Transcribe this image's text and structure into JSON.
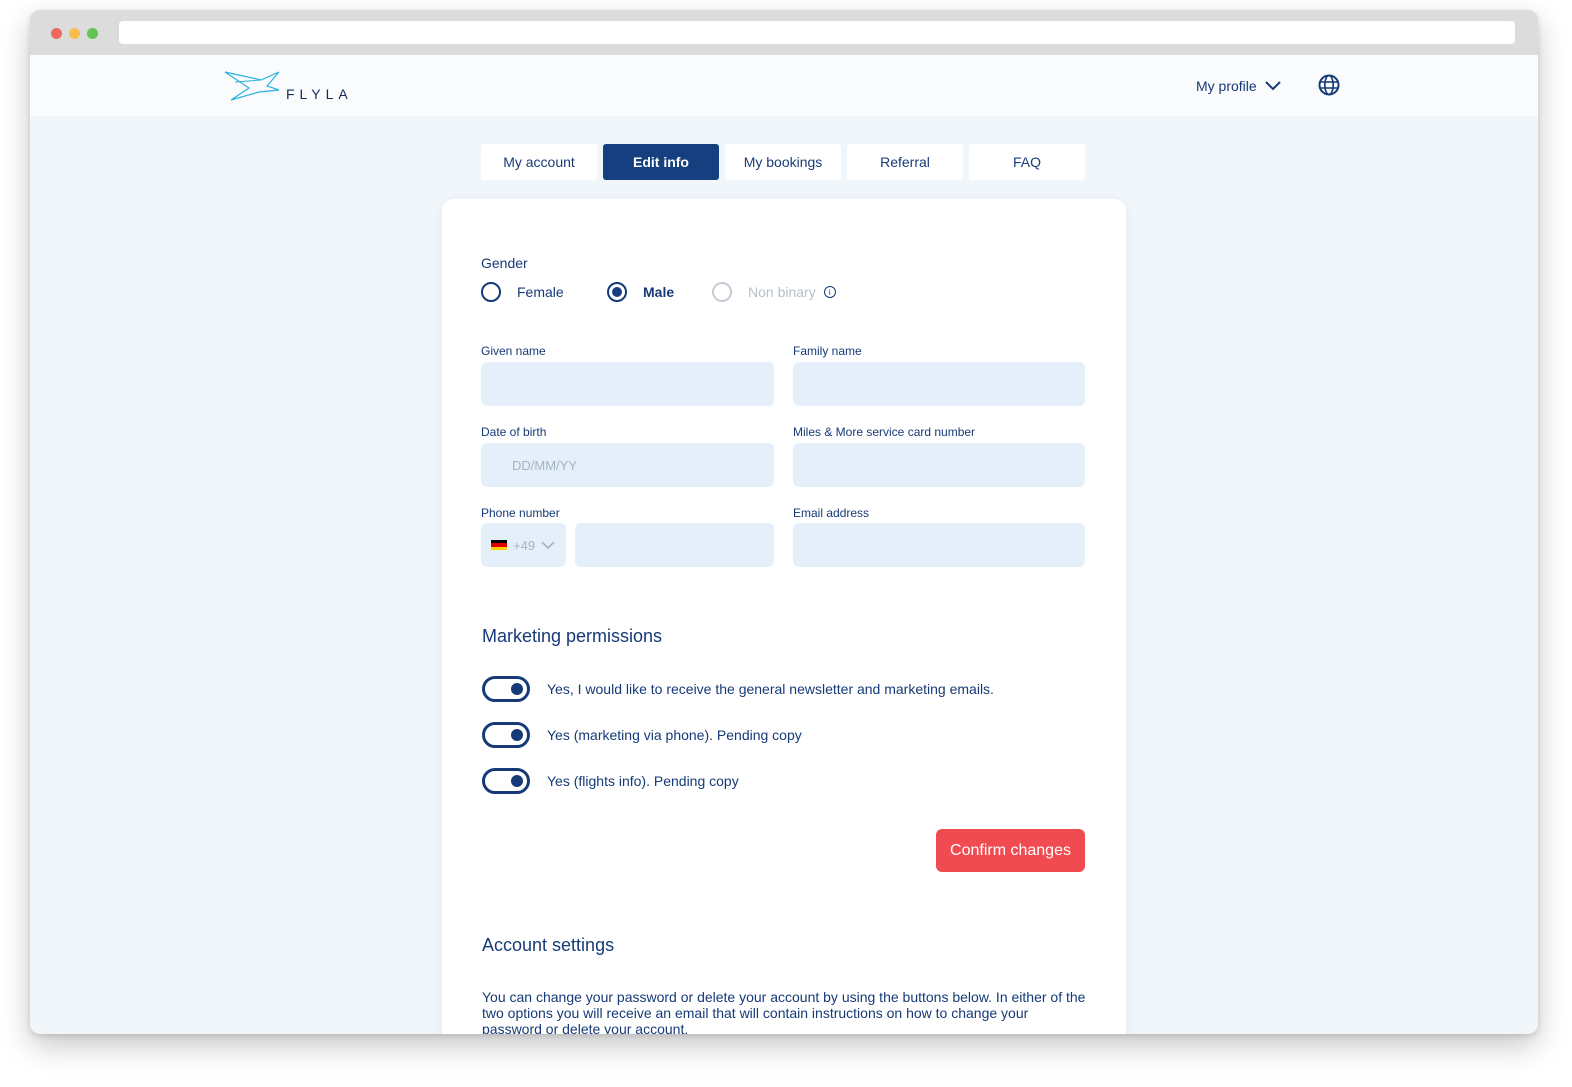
{
  "brand": {
    "name": "FLYLA",
    "accent": "#163f80",
    "cta_color": "#ef4b51"
  },
  "header": {
    "profile_label": "My profile",
    "profile_icon": "chevron-down-icon",
    "language_icon": "globe-icon"
  },
  "tabs": [
    {
      "label": "My account",
      "active": false
    },
    {
      "label": "Edit info",
      "active": true
    },
    {
      "label": "My bookings",
      "active": false
    },
    {
      "label": "Referral",
      "active": false
    },
    {
      "label": "FAQ",
      "active": false
    }
  ],
  "form": {
    "gender": {
      "label": "Gender",
      "options": [
        {
          "label": "Female",
          "checked": false,
          "disabled": false
        },
        {
          "label": "Male",
          "checked": true,
          "disabled": false
        },
        {
          "label": "Non binary",
          "checked": false,
          "disabled": true
        }
      ]
    },
    "given_name": {
      "label": "Given name",
      "value": ""
    },
    "family_name": {
      "label": "Family name",
      "value": ""
    },
    "date_of_birth": {
      "label": "Date of birth",
      "placeholder": "DD/MM/YY",
      "value": ""
    },
    "miles_card": {
      "label": "Miles & More service card number",
      "value": ""
    },
    "phone": {
      "label": "Phone number",
      "country_code": "+49",
      "country_flag": "de-flag",
      "value": ""
    },
    "email": {
      "label": "Email address",
      "value": ""
    }
  },
  "marketing": {
    "title": "Marketing permissions",
    "toggles": [
      {
        "label": "Yes, I would like to receive the general newsletter and marketing emails.",
        "on": true
      },
      {
        "label": "Yes (marketing via phone). Pending copy",
        "on": true
      },
      {
        "label": "Yes (flights info). Pending copy",
        "on": true
      }
    ]
  },
  "confirm_label": "Confirm changes",
  "account_settings": {
    "title": "Account settings",
    "description": "You can change your password or delete your account by using the buttons below. In either of the two options you will receive an email that will contain instructions on how to change your password or delete your account."
  }
}
